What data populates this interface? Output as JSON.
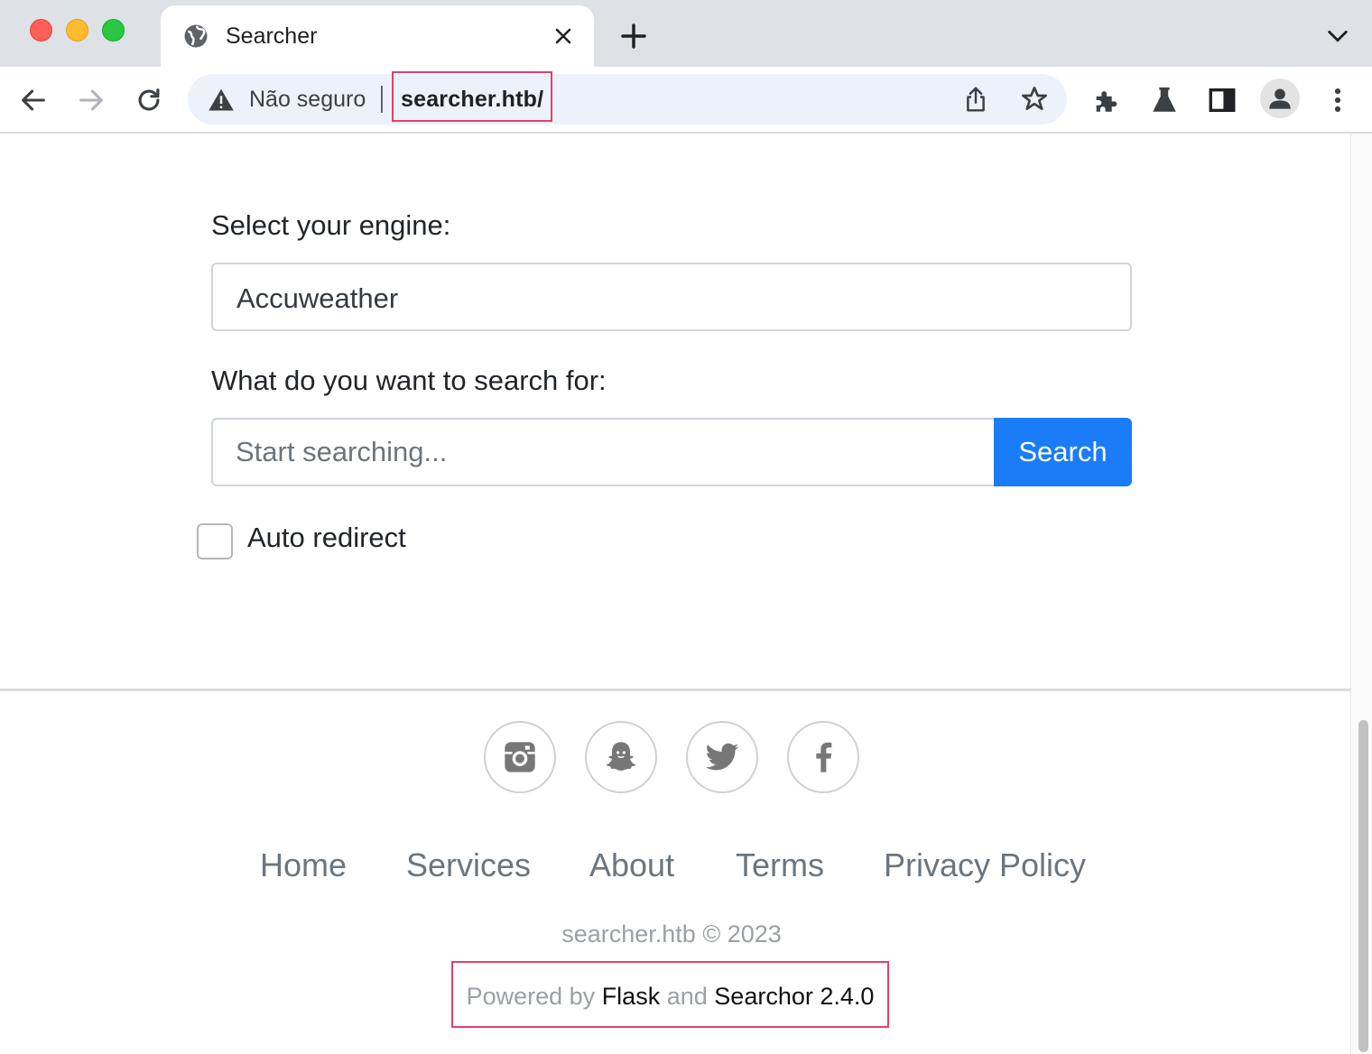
{
  "browser": {
    "tab": {
      "title": "Searcher"
    },
    "omnibox": {
      "security_label": "Não seguro",
      "url": "searcher.htb/"
    },
    "icons": [
      "back-icon",
      "forward-icon",
      "reload-icon",
      "share-icon",
      "star-icon",
      "extensions-icon",
      "labs-icon",
      "side-panel-icon",
      "profile-icon",
      "menu-icon"
    ]
  },
  "form": {
    "engine_label": "Select your engine:",
    "engine_value": "Accuweather",
    "query_label": "What do you want to search for:",
    "query_placeholder": "Start searching...",
    "query_value": "",
    "search_button": "Search",
    "auto_redirect_label": "Auto redirect",
    "auto_redirect_checked": false
  },
  "footer": {
    "social": [
      "instagram-icon",
      "snapchat-icon",
      "twitter-icon",
      "facebook-icon"
    ],
    "links": [
      "Home",
      "Services",
      "About",
      "Terms",
      "Privacy Policy"
    ],
    "copyright": "searcher.htb © 2023",
    "powered": {
      "prefix": "Powered by",
      "flask": "Flask",
      "and": "and",
      "searchor": "Searchor 2.4.0"
    }
  },
  "colors": {
    "accent": "#1a7cf7",
    "highlight": "#e2406a"
  }
}
